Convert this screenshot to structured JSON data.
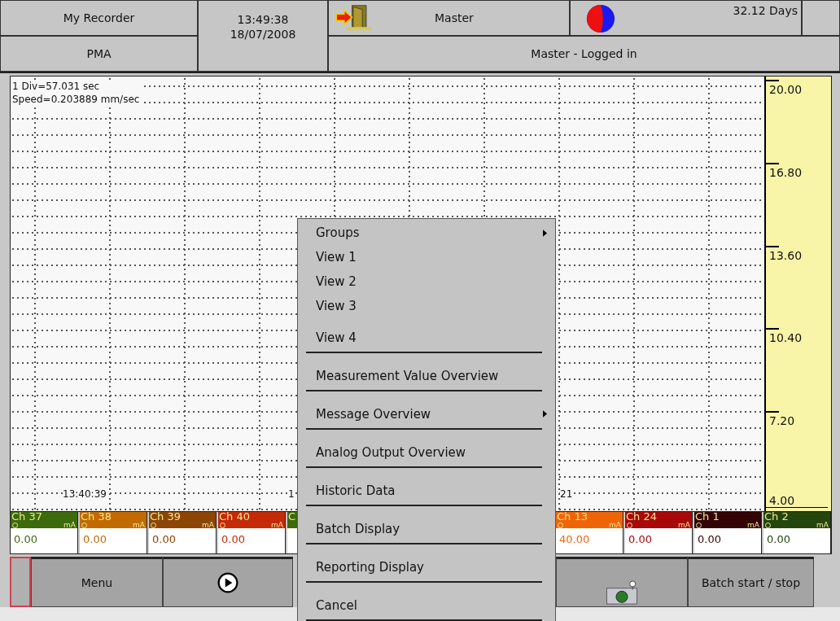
{
  "header": {
    "device": "My Recorder",
    "site": "PMA",
    "time": "13:49:38",
    "date": "18/07/2008",
    "user": "Master",
    "memory": "32.12 Days",
    "status": "Master - Logged in"
  },
  "chart": {
    "info": [
      "1 Div=57.031 sec",
      "Speed=0.203889 mm/sec"
    ],
    "time_labels": [
      {
        "text": "13:40:39",
        "kind": "full"
      },
      {
        "text": "1",
        "kind": "cut_right"
      },
      {
        "text": "21",
        "kind": "cut_left"
      }
    ],
    "scale": [
      "20.00",
      "16.80",
      "13.60",
      "10.40",
      "7.20",
      "4.00"
    ]
  },
  "channels_left": [
    {
      "label": "Ch 37",
      "unit": "mA",
      "value": "0.00",
      "color": "#3c6a0c",
      "kind": "full"
    },
    {
      "label": "Ch 38",
      "unit": "mA",
      "value": "0.00",
      "color": "#c26a00",
      "kind": "full"
    },
    {
      "label": "Ch 39",
      "unit": "mA",
      "value": "0.00",
      "color": "#8c4504",
      "kind": "full"
    },
    {
      "label": "Ch 40",
      "unit": "mA",
      "value": "0.00",
      "color": "#c42a08",
      "kind": "full"
    },
    {
      "label": "C",
      "color": "#3c6a0c",
      "kind": "partial"
    }
  ],
  "channels_right": [
    {
      "label": "Ch 13",
      "unit": "mA",
      "value": "40.00",
      "color": "#f06408",
      "kind": "full"
    },
    {
      "label": "Ch 24",
      "unit": "mA",
      "value": "0.00",
      "color": "#a80808",
      "kind": "full"
    },
    {
      "label": "Ch 1",
      "unit": "mA",
      "value": "0.00",
      "color": "#340404",
      "kind": "full"
    },
    {
      "label": "Ch 2",
      "unit": "mA",
      "value": "0.00",
      "color": "#24460c",
      "kind": "full"
    }
  ],
  "toolbar": {
    "menu": "Menu",
    "batch": "Batch start / stop"
  },
  "context_menu": [
    {
      "label": "Groups",
      "submenu": true,
      "separator": false
    },
    {
      "label": "View 1",
      "submenu": false,
      "separator": false
    },
    {
      "label": "View 2",
      "submenu": false,
      "separator": false
    },
    {
      "label": "View 3",
      "submenu": false,
      "separator": false
    },
    {
      "label": "View 4",
      "submenu": false,
      "separator": true
    },
    {
      "label": "Measurement Value Overview",
      "submenu": false,
      "separator": true
    },
    {
      "label": "Message Overview",
      "submenu": true,
      "separator": true
    },
    {
      "label": "Analog Output Overview",
      "submenu": false,
      "separator": true
    },
    {
      "label": "Historic Data",
      "submenu": false,
      "separator": true
    },
    {
      "label": "Batch Display",
      "submenu": false,
      "separator": true
    },
    {
      "label": "Reporting Display",
      "submenu": false,
      "separator": true
    },
    {
      "label": "Cancel",
      "submenu": false,
      "separator": true
    }
  ]
}
